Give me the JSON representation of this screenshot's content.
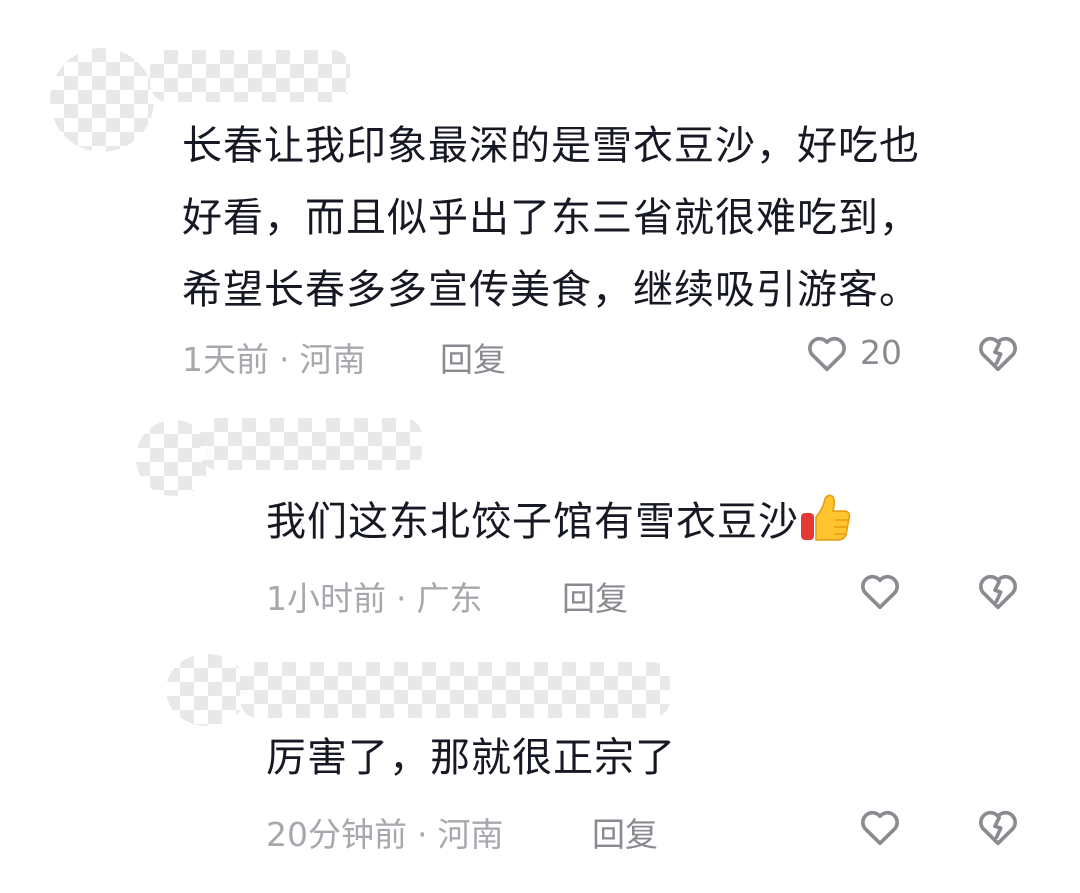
{
  "comments": [
    {
      "text": "长春让我印象最深的是雪衣豆沙，好吃也\n好看，而且似乎出了东三省就很难吃到，\n希望长春多多宣传美食，继续吸引游客。",
      "time": "1天前",
      "location": "河南",
      "reply_label": "回复",
      "likes": "20"
    },
    {
      "text": "我们这东北饺子馆有雪衣豆沙",
      "emoji": "thumbs-up",
      "time": "1小时前",
      "location": "广东",
      "reply_label": "回复"
    },
    {
      "text": "厉害了，那就很正宗了",
      "time": "20分钟前",
      "location": "河南",
      "reply_label": "回复"
    }
  ],
  "separator": "·",
  "icons": {
    "like": "heart-outline-icon",
    "dislike": "broken-heart-icon"
  },
  "colors": {
    "text": "#161823",
    "meta": "#a7a8ad",
    "icon": "#8a8b91"
  }
}
